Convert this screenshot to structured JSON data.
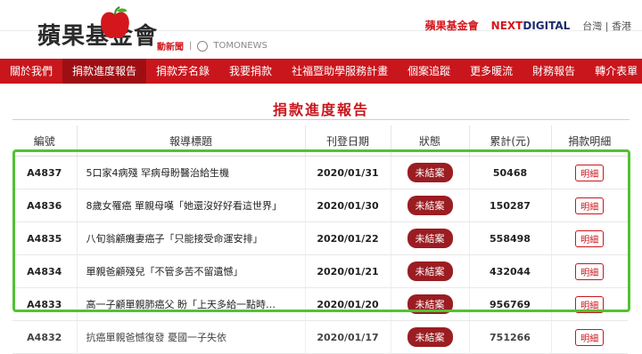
{
  "header": {
    "logo_text": "蘋果基金會",
    "sub_logo_1": "動新聞",
    "sub_logo_2": "TOMONEWS",
    "brand_1": "蘋果基金會",
    "brand_2_prefix": "NEXT",
    "brand_2_suffix": "DIGITAL",
    "regions": "台灣 | 香港"
  },
  "nav": {
    "items": [
      "關於我們",
      "捐款進度報告",
      "捐款芳名錄",
      "我要捐款",
      "社福暨助學服務計畫",
      "個案追蹤",
      "更多暖流",
      "財務報告",
      "轉介表單"
    ],
    "active_index": 1
  },
  "page_title": "捐款進度報告",
  "table": {
    "headers": [
      "編號",
      "報導標題",
      "刊登日期",
      "狀態",
      "累計(元)",
      "捐款明細"
    ],
    "rows": [
      {
        "id": "A4837",
        "title": "5口家4病殘 罕病母盼醫治給生機",
        "date": "2020/01/31",
        "status": "未結案",
        "total": "50468",
        "detail": "明細"
      },
      {
        "id": "A4836",
        "title": "8歲女罹癌 單親母嘆「她還沒好好看這世界」",
        "date": "2020/01/30",
        "status": "未結案",
        "total": "150287",
        "detail": "明細"
      },
      {
        "id": "A4835",
        "title": "八旬翁顧癱妻癌子「只能接受命運安排」",
        "date": "2020/01/22",
        "status": "未結案",
        "total": "558498",
        "detail": "明細"
      },
      {
        "id": "A4834",
        "title": "單親爸顧殘兒「不管多苦不留遺憾」",
        "date": "2020/01/21",
        "status": "未結案",
        "total": "432044",
        "detail": "明細"
      },
      {
        "id": "A4833",
        "title": "高一子顧單親肺癌父 盼「上天多給一點時…",
        "date": "2020/01/20",
        "status": "未結案",
        "total": "956769",
        "detail": "明細"
      },
      {
        "id": "A4832",
        "title": "抗癌單親爸憾復發 憂國一子失依",
        "date": "2020/01/17",
        "status": "未結案",
        "total": "751266",
        "detail": "明細"
      }
    ]
  },
  "colors": {
    "brand_red": "#c9161d",
    "status_bg": "#9a1d22",
    "highlight_green": "#52c234"
  }
}
